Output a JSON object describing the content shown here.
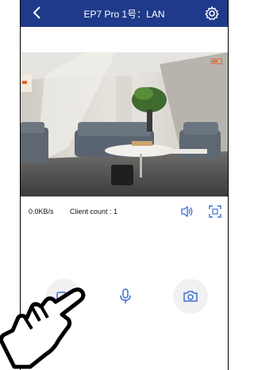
{
  "header": {
    "title": "EP7 Pro 1号：LAN",
    "back_icon": "chevron-left-icon",
    "settings_icon": "gear-icon",
    "bg_color": "#1f3a8a"
  },
  "video": {
    "battery_icon": "battery-icon"
  },
  "status": {
    "speed": "0.0KB/s",
    "clients": "Client count : 1",
    "speaker_icon": "speaker-icon",
    "fullscreen_icon": "fullscreen-icon"
  },
  "controls": {
    "record_icon": "video-record-icon",
    "mic_icon": "microphone-icon",
    "camera_icon": "camera-icon",
    "accent": "#3a6fd0"
  }
}
